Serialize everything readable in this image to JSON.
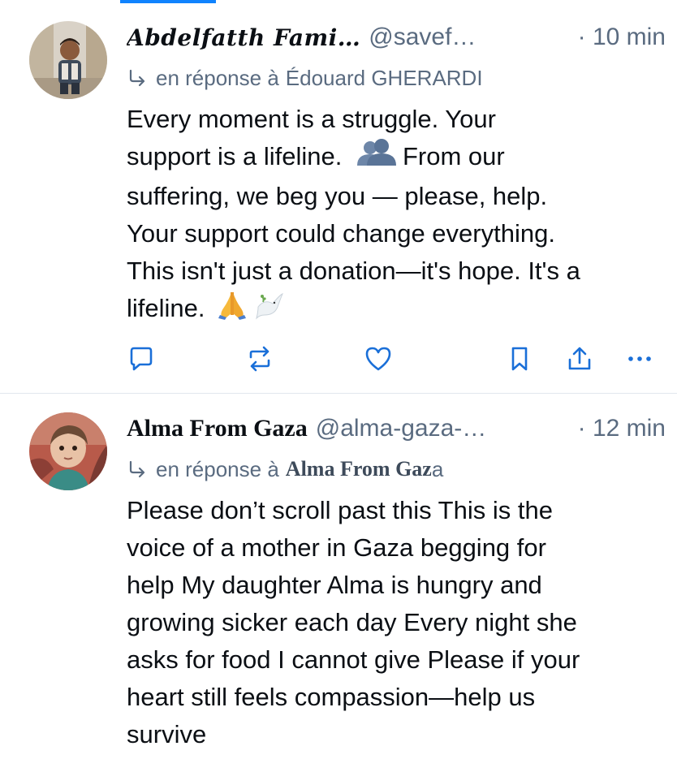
{
  "posts": [
    {
      "display_name": "Abdelfatth Fami…",
      "handle": "@savef…",
      "time": "· 10 min",
      "reply_prefix": "en réponse à",
      "reply_to": "Édouard GHERARDI",
      "body_lines": [
        "Every moment is a struggle. Your",
        "support is a lifeline.",
        "From our",
        "suffering, we beg you — please, help.",
        "Your support could change everything.",
        "This isn't just a donation—it's hope. It's a",
        "lifeline."
      ],
      "emojis": [
        "busts-in-silhouette",
        "folded-hands",
        "dove"
      ],
      "actions": [
        "reply-icon",
        "repost-icon",
        "like-icon",
        "bookmark-icon",
        "share-icon",
        "more-icon"
      ]
    },
    {
      "display_name": "Alma From Gaza",
      "handle": "@alma-gaza-…",
      "time": "· 12 min",
      "reply_prefix": "en réponse à",
      "reply_to": "Alma From Gaz",
      "reply_to_tail": "a",
      "body_lines": [
        "Please don’t scroll past this This is the",
        "voice of a mother in Gaza begging for",
        "help My daughter Alma is hungry and",
        "growing sicker each day Every night she",
        "asks for food I cannot give Please if your",
        "heart still feels compassion—help us",
        "survive"
      ]
    }
  ],
  "colors": {
    "accent": "#1083fe",
    "icon": "#1a6fd8",
    "muted_text": "#5a6b80",
    "divider": "#e2e7ee"
  }
}
